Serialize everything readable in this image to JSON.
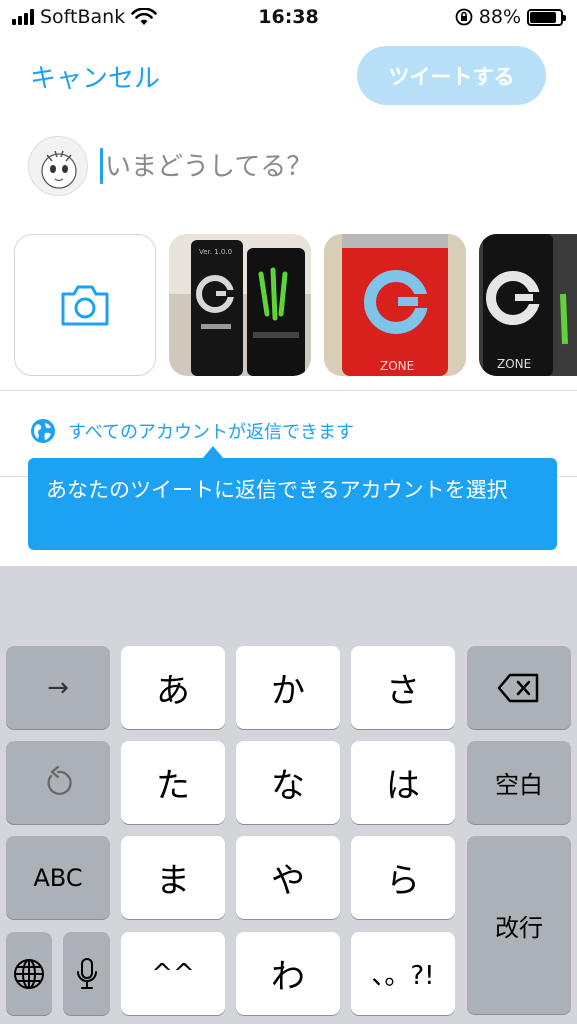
{
  "status_bar": {
    "carrier": "SoftBank",
    "time": "16:38",
    "battery_percent": "88%",
    "battery_level": 0.88
  },
  "header": {
    "cancel_label": "キャンセル",
    "tweet_label": "ツイートする",
    "tweet_color": "#b9e0f9",
    "accent_color": "#1da1f2"
  },
  "compose": {
    "placeholder": "いまどうしてる？"
  },
  "media": {
    "camera_icon": "camera-icon",
    "thumbnails": [
      {
        "caption": "Ver. 1.0.0"
      },
      {
        "caption": "ZONE"
      },
      {
        "caption": "ZONE"
      }
    ]
  },
  "reply": {
    "icon": "globe-icon",
    "label": "すべてのアカウントが返信できます"
  },
  "tooltip": {
    "text": "あなたのツイートに返信できるアカウントを選択"
  },
  "keyboard": {
    "row1": [
      "→",
      "あ",
      "か",
      "さ",
      "⌫"
    ],
    "row2": [
      "↺",
      "た",
      "な",
      "は",
      "空白"
    ],
    "row3": [
      "ABC",
      "ま",
      "や",
      "ら"
    ],
    "row4": [
      "🌐",
      "🎤",
      "^^",
      "わ",
      "、。?!"
    ],
    "enter_label": "改行"
  }
}
